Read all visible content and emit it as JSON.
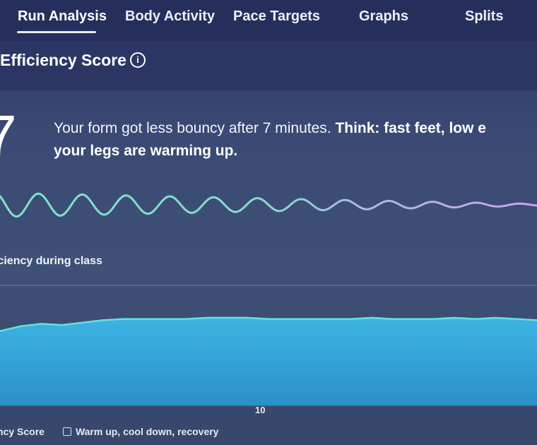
{
  "nav": {
    "tabs": [
      {
        "label": "Run Analysis",
        "active": true
      },
      {
        "label": "Body Activity",
        "active": false
      },
      {
        "label": "Pace Targets",
        "active": false
      },
      {
        "label": "Graphs",
        "active": false
      },
      {
        "label": "Splits",
        "active": false
      }
    ]
  },
  "section": {
    "title": "Efficiency Score",
    "info_icon": "info-icon"
  },
  "score": {
    "value": "7",
    "message_plain": "Your form got less bouncy after 7 minutes. ",
    "message_bold_1": "Think: fast feet, low e",
    "message_bold_2": "your legs are warming up."
  },
  "efficiency_chart": {
    "title": "iciency during class",
    "x_tick": "10",
    "legend_left": "ncy Score",
    "legend_right": "Warm up, cool down, recovery",
    "colors": {
      "line": "#5fe0e0",
      "fill": "#2fa4d8",
      "wave_start": "#79e6c9",
      "wave_end": "#c9a2ec"
    }
  },
  "chart_data": {
    "type": "area",
    "title": "iciency during class",
    "x_ticks": [
      "10"
    ],
    "series": [
      {
        "values": [
          62,
          66,
          68,
          67,
          69,
          71,
          72,
          72,
          72,
          72,
          73,
          73,
          73,
          72,
          72,
          72,
          72,
          72,
          73,
          72,
          72,
          72,
          73,
          72,
          73,
          72,
          71
        ]
      }
    ],
    "ylim": [
      0,
      100
    ],
    "grid": true
  }
}
